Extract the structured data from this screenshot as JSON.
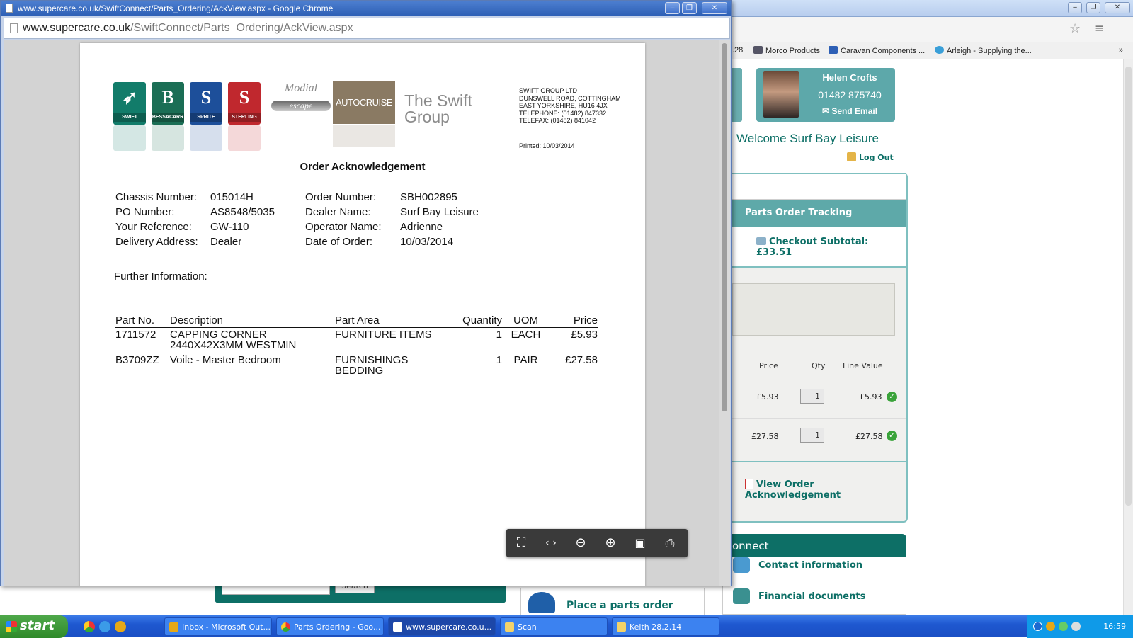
{
  "background": {
    "bookmarks": [
      ".28",
      "Morco Products",
      "Caravan Components ...",
      "Arleigh - Supplying the..."
    ],
    "bookmarks_more": "»",
    "rep": {
      "name": "Helen Crofts",
      "phone": "01482 875740",
      "email_label": "Send Email"
    },
    "welcome": "Welcome Surf Bay Leisure",
    "logout": "Log Out",
    "panel_title": "Parts Order Tracking",
    "checkout_subtotal": "Checkout Subtotal: £33.51",
    "columns": {
      "price": "Price",
      "qty": "Qty",
      "line_value": "Line Value"
    },
    "rows": [
      {
        "price": "£5.93",
        "qty": "1",
        "line_value": "£5.93"
      },
      {
        "price": "£27.58",
        "qty": "1",
        "line_value": "£27.58"
      }
    ],
    "view_ack": "View Order Acknowledgement",
    "connect_title": "onnect",
    "connect_links": [
      "Contact information",
      "Financial documents"
    ],
    "search_button": "Search",
    "place_order": "Place a parts order"
  },
  "popup": {
    "title": "www.supercare.co.uk/SwiftConnect/Parts_Ordering/AckView.aspx - Google Chrome",
    "url_domain": "www.supercare.co.uk",
    "url_path": "/SwiftConnect/Parts_Ordering/AckView.aspx"
  },
  "document": {
    "logos": [
      {
        "label": "SWIFT",
        "mark": "S",
        "color": "#127c6a"
      },
      {
        "label": "BESSACARR",
        "mark": "B",
        "color": "#1b6e55"
      },
      {
        "label": "SPRITE",
        "mark": "S",
        "color": "#1d4f9a"
      },
      {
        "label": "STERLING",
        "mark": "S",
        "color": "#c0282e"
      }
    ],
    "modial": "Modial",
    "escape": "escape",
    "autocruise": "AUTOCRUISE",
    "group_name": "The Swift Group",
    "company_lines": [
      "SWIFT GROUP LTD",
      "DUNSWELL ROAD, COTTINGHAM",
      "EAST YORKSHIRE, HU16 4JX",
      "TELEPHONE: (01482) 847332",
      "TELEFAX: (01482) 841042"
    ],
    "printed": "Printed: 10/03/2014",
    "title": "Order Acknowledgement",
    "fields_left": [
      {
        "label": "Chassis Number:",
        "value": "015014H"
      },
      {
        "label": "PO Number:",
        "value": "AS8548/5035"
      },
      {
        "label": "Your Reference:",
        "value": "GW-110"
      },
      {
        "label": "Delivery Address:",
        "value": "Dealer"
      }
    ],
    "fields_right": [
      {
        "label": "Order Number:",
        "value": "SBH002895"
      },
      {
        "label": "Dealer Name:",
        "value": "Surf Bay Leisure"
      },
      {
        "label": "Operator Name:",
        "value": "Adrienne"
      },
      {
        "label": "Date of Order:",
        "value": "10/03/2014"
      }
    ],
    "further_info": "Further Information:",
    "table_headers": [
      "Part No.",
      "Description",
      "Part Area",
      "Quantity",
      "UOM",
      "Price"
    ],
    "parts": [
      {
        "part_no": "1711572",
        "description": "CAPPING CORNER 2440X42X3MM WESTMIN",
        "area": "FURNITURE ITEMS",
        "qty": "1",
        "uom": "EACH",
        "price": "£5.93"
      },
      {
        "part_no": "B3709ZZ",
        "description": "Voile - Master Bedroom",
        "area": "FURNISHINGS BEDDING",
        "qty": "1",
        "uom": "PAIR",
        "price": "£27.58"
      }
    ]
  },
  "toolbar_icons": [
    "fit-page-icon",
    "fit-width-icon",
    "zoom-out-icon",
    "zoom-in-icon",
    "save-icon",
    "print-icon"
  ],
  "taskbar": {
    "start": "start",
    "tasks": [
      {
        "label": "Inbox - Microsoft Out...",
        "color": "#e6a817"
      },
      {
        "label": "Parts Ordering - Goo...",
        "color": "#3a9d3a"
      },
      {
        "label": "www.supercare.co.u...",
        "color": "#ffffff"
      },
      {
        "label": "Scan",
        "color": "#f3d26a"
      },
      {
        "label": "Keith 28.2.14",
        "color": "#f3d26a"
      }
    ],
    "clock": "16:59"
  }
}
